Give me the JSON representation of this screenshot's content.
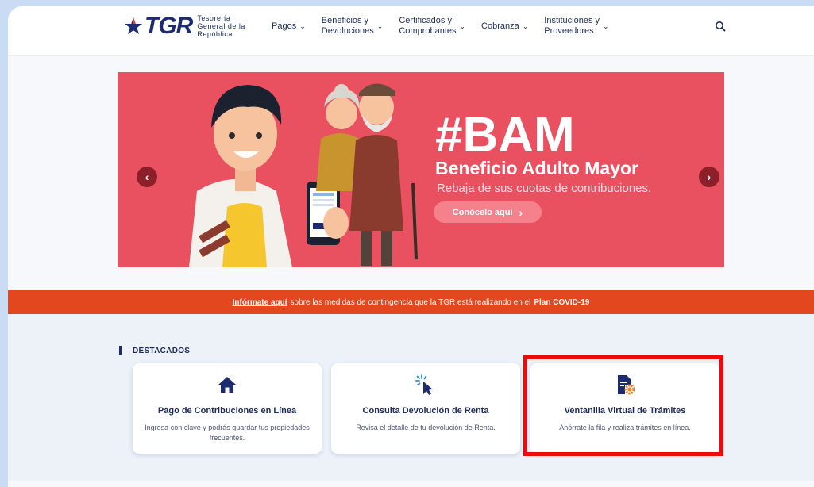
{
  "header": {
    "logo_text": "TGR",
    "logo_subtitle_1": "Tesorería",
    "logo_subtitle_2": "General de la",
    "logo_subtitle_3": "República",
    "nav": [
      {
        "line1": "Pagos",
        "line2": ""
      },
      {
        "line1": "Beneficios y",
        "line2": "Devoluciones"
      },
      {
        "line1": "Certificados y",
        "line2": "Comprobantes"
      },
      {
        "line1": "Cobranza",
        "line2": ""
      },
      {
        "line1": "Instituciones y",
        "line2": "Proveedores"
      }
    ],
    "search_icon": "search-icon"
  },
  "banner": {
    "hashtag": "#BAM",
    "title": "Beneficio Adulto Mayor",
    "subtitle": "Rebaja de sus cuotas de contribuciones.",
    "button_label": "Conócelo aquí",
    "button_icon": "›",
    "prev_icon": "‹",
    "next_icon": "›",
    "background_color": "#e95060"
  },
  "notice": {
    "link_text": "Infórmate aquí",
    "middle_text": "sobre las medidas de contingencia que la TGR está realizando en el",
    "plan_text": "Plan COVID-19",
    "background_color": "#e2471f"
  },
  "destacados": {
    "title": "DESTACADOS",
    "cards": [
      {
        "icon": "home-icon",
        "title": "Pago de Contribuciones en Línea",
        "desc": "Ingresa con clave y podrás guardar tus propiedades frecuentes."
      },
      {
        "icon": "cursor-click-icon",
        "title": "Consulta Devolución de Renta",
        "desc": "Revisa el detalle de tu devolución de Renta."
      },
      {
        "icon": "document-gear-icon",
        "title": "Ventanilla Virtual de Trámites",
        "desc": "Ahórrate la fila y realiza trámites en línea."
      }
    ],
    "highlight_color": "#ee0a0a"
  }
}
